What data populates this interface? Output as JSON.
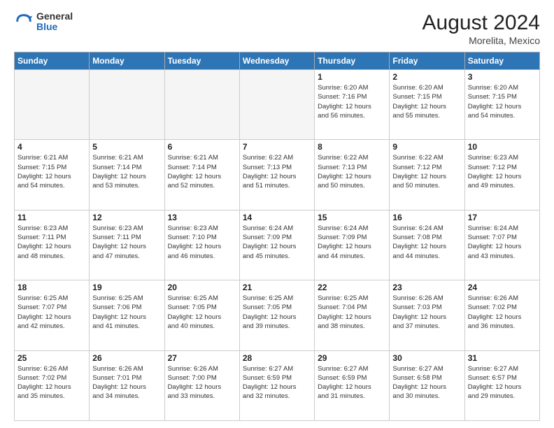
{
  "logo": {
    "general": "General",
    "blue": "Blue"
  },
  "title": {
    "month_year": "August 2024",
    "location": "Morelita, Mexico"
  },
  "weekdays": [
    "Sunday",
    "Monday",
    "Tuesday",
    "Wednesday",
    "Thursday",
    "Friday",
    "Saturday"
  ],
  "weeks": [
    [
      {
        "day": "",
        "info": ""
      },
      {
        "day": "",
        "info": ""
      },
      {
        "day": "",
        "info": ""
      },
      {
        "day": "",
        "info": ""
      },
      {
        "day": "1",
        "info": "Sunrise: 6:20 AM\nSunset: 7:16 PM\nDaylight: 12 hours\nand 56 minutes."
      },
      {
        "day": "2",
        "info": "Sunrise: 6:20 AM\nSunset: 7:15 PM\nDaylight: 12 hours\nand 55 minutes."
      },
      {
        "day": "3",
        "info": "Sunrise: 6:20 AM\nSunset: 7:15 PM\nDaylight: 12 hours\nand 54 minutes."
      }
    ],
    [
      {
        "day": "4",
        "info": "Sunrise: 6:21 AM\nSunset: 7:15 PM\nDaylight: 12 hours\nand 54 minutes."
      },
      {
        "day": "5",
        "info": "Sunrise: 6:21 AM\nSunset: 7:14 PM\nDaylight: 12 hours\nand 53 minutes."
      },
      {
        "day": "6",
        "info": "Sunrise: 6:21 AM\nSunset: 7:14 PM\nDaylight: 12 hours\nand 52 minutes."
      },
      {
        "day": "7",
        "info": "Sunrise: 6:22 AM\nSunset: 7:13 PM\nDaylight: 12 hours\nand 51 minutes."
      },
      {
        "day": "8",
        "info": "Sunrise: 6:22 AM\nSunset: 7:13 PM\nDaylight: 12 hours\nand 50 minutes."
      },
      {
        "day": "9",
        "info": "Sunrise: 6:22 AM\nSunset: 7:12 PM\nDaylight: 12 hours\nand 50 minutes."
      },
      {
        "day": "10",
        "info": "Sunrise: 6:23 AM\nSunset: 7:12 PM\nDaylight: 12 hours\nand 49 minutes."
      }
    ],
    [
      {
        "day": "11",
        "info": "Sunrise: 6:23 AM\nSunset: 7:11 PM\nDaylight: 12 hours\nand 48 minutes."
      },
      {
        "day": "12",
        "info": "Sunrise: 6:23 AM\nSunset: 7:11 PM\nDaylight: 12 hours\nand 47 minutes."
      },
      {
        "day": "13",
        "info": "Sunrise: 6:23 AM\nSunset: 7:10 PM\nDaylight: 12 hours\nand 46 minutes."
      },
      {
        "day": "14",
        "info": "Sunrise: 6:24 AM\nSunset: 7:09 PM\nDaylight: 12 hours\nand 45 minutes."
      },
      {
        "day": "15",
        "info": "Sunrise: 6:24 AM\nSunset: 7:09 PM\nDaylight: 12 hours\nand 44 minutes."
      },
      {
        "day": "16",
        "info": "Sunrise: 6:24 AM\nSunset: 7:08 PM\nDaylight: 12 hours\nand 44 minutes."
      },
      {
        "day": "17",
        "info": "Sunrise: 6:24 AM\nSunset: 7:07 PM\nDaylight: 12 hours\nand 43 minutes."
      }
    ],
    [
      {
        "day": "18",
        "info": "Sunrise: 6:25 AM\nSunset: 7:07 PM\nDaylight: 12 hours\nand 42 minutes."
      },
      {
        "day": "19",
        "info": "Sunrise: 6:25 AM\nSunset: 7:06 PM\nDaylight: 12 hours\nand 41 minutes."
      },
      {
        "day": "20",
        "info": "Sunrise: 6:25 AM\nSunset: 7:05 PM\nDaylight: 12 hours\nand 40 minutes."
      },
      {
        "day": "21",
        "info": "Sunrise: 6:25 AM\nSunset: 7:05 PM\nDaylight: 12 hours\nand 39 minutes."
      },
      {
        "day": "22",
        "info": "Sunrise: 6:25 AM\nSunset: 7:04 PM\nDaylight: 12 hours\nand 38 minutes."
      },
      {
        "day": "23",
        "info": "Sunrise: 6:26 AM\nSunset: 7:03 PM\nDaylight: 12 hours\nand 37 minutes."
      },
      {
        "day": "24",
        "info": "Sunrise: 6:26 AM\nSunset: 7:02 PM\nDaylight: 12 hours\nand 36 minutes."
      }
    ],
    [
      {
        "day": "25",
        "info": "Sunrise: 6:26 AM\nSunset: 7:02 PM\nDaylight: 12 hours\nand 35 minutes."
      },
      {
        "day": "26",
        "info": "Sunrise: 6:26 AM\nSunset: 7:01 PM\nDaylight: 12 hours\nand 34 minutes."
      },
      {
        "day": "27",
        "info": "Sunrise: 6:26 AM\nSunset: 7:00 PM\nDaylight: 12 hours\nand 33 minutes."
      },
      {
        "day": "28",
        "info": "Sunrise: 6:27 AM\nSunset: 6:59 PM\nDaylight: 12 hours\nand 32 minutes."
      },
      {
        "day": "29",
        "info": "Sunrise: 6:27 AM\nSunset: 6:59 PM\nDaylight: 12 hours\nand 31 minutes."
      },
      {
        "day": "30",
        "info": "Sunrise: 6:27 AM\nSunset: 6:58 PM\nDaylight: 12 hours\nand 30 minutes."
      },
      {
        "day": "31",
        "info": "Sunrise: 6:27 AM\nSunset: 6:57 PM\nDaylight: 12 hours\nand 29 minutes."
      }
    ]
  ]
}
